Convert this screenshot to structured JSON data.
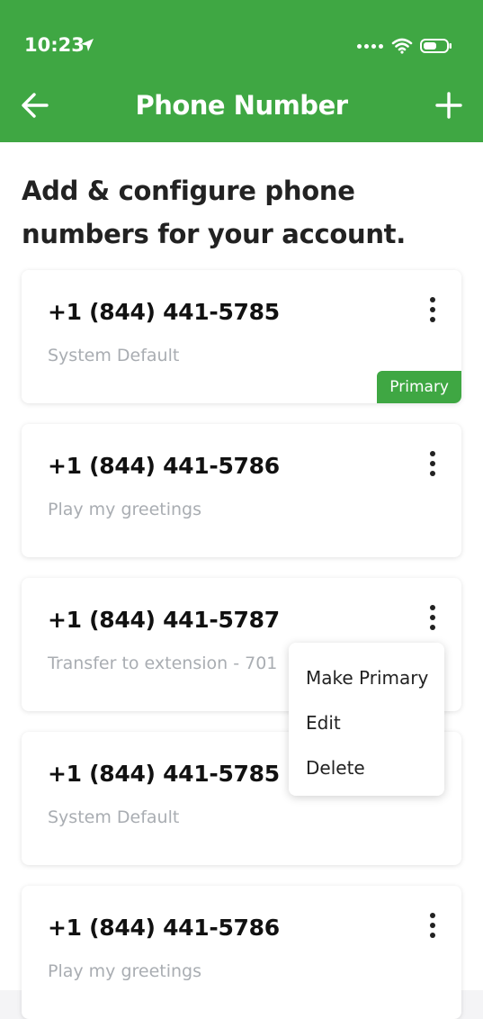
{
  "status_bar": {
    "time": "10:23"
  },
  "nav": {
    "title": "Phone Number"
  },
  "intro": "Add & configure phone numbers for your account.",
  "cards": [
    {
      "number": "+1 (844) 441-5785",
      "desc": "System Default",
      "badge": "Primary"
    },
    {
      "number": "+1 (844) 441-5786",
      "desc": "Play my greetings"
    },
    {
      "number": "+1 (844) 441-5787",
      "desc": "Transfer to extension - 701"
    },
    {
      "number": "+1 (844) 441-5785",
      "desc": "System Default"
    },
    {
      "number": "+1 (844) 441-5786",
      "desc": "Play my greetings"
    }
  ],
  "menu": {
    "items": [
      "Make Primary",
      "Edit",
      "Delete"
    ]
  },
  "colors": {
    "brand_green": "#3fa743",
    "muted_text": "#a9adb2"
  }
}
